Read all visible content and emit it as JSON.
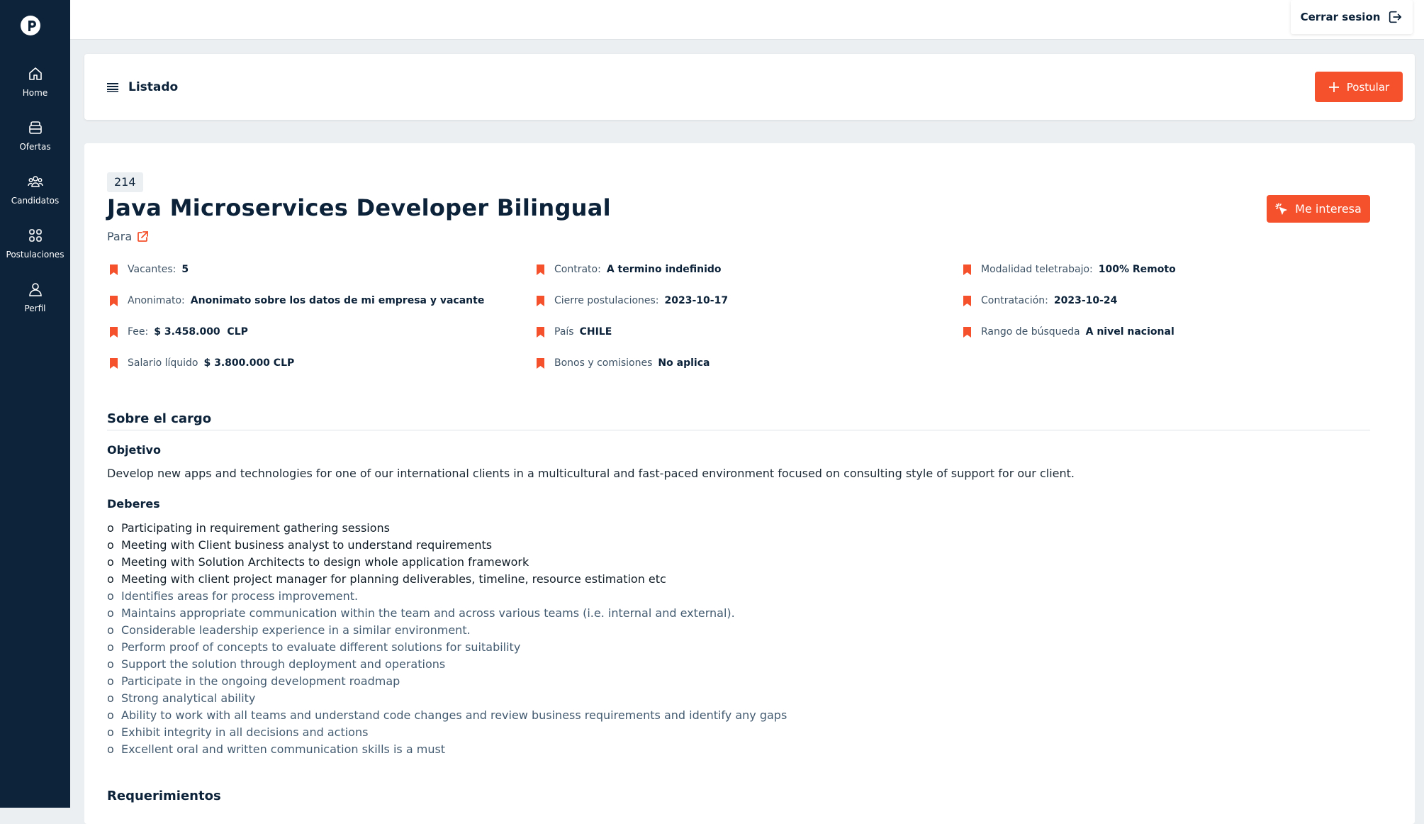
{
  "sidebar": {
    "items": [
      {
        "label": "Home",
        "icon": "home-icon"
      },
      {
        "label": "Ofertas",
        "icon": "briefcase-icon"
      },
      {
        "label": "Candidatos",
        "icon": "users-icon"
      },
      {
        "label": "Postulaciones",
        "icon": "grid-icon"
      },
      {
        "label": "Perfil",
        "icon": "user-icon"
      }
    ]
  },
  "topbar": {
    "logout_label": "Cerrar sesion"
  },
  "header": {
    "listado_label": "Listado",
    "postular_label": "Postular"
  },
  "job": {
    "id": "214",
    "title": "Java Microservices Developer Bilingual",
    "para_label": "Para",
    "interest_label": "Me interesa",
    "attributes": [
      {
        "label": "Vacantes:",
        "value": "5"
      },
      {
        "label": "Contrato:",
        "value": "A termino indefinido"
      },
      {
        "label": "Modalidad teletrabajo:",
        "value": "100% Remoto"
      },
      {
        "label": "Anonimato:",
        "value": "Anonimato sobre los datos de mi empresa y vacante"
      },
      {
        "label": "Cierre postulaciones:",
        "value": "2023-10-17"
      },
      {
        "label": "Contratación:",
        "value": "2023-10-24"
      },
      {
        "label": "Fee:",
        "value": "$ 3.458.000  CLP"
      },
      {
        "label": "País",
        "value": "CHILE"
      },
      {
        "label": "Rango de búsqueda",
        "value": "A nivel nacional"
      },
      {
        "label": "Salario líquido",
        "value": "$ 3.800.000 CLP"
      },
      {
        "label": "Bonos y comisiones",
        "value": "No aplica"
      }
    ],
    "about_title": "Sobre el cargo",
    "objective_title": "Objetivo",
    "objective_text": "Develop new apps and technologies for one of our international clients in a multicultural and fast-paced environment focused on consulting style of support for our client.",
    "duties_title": "Deberes",
    "duty_marker": "o",
    "duties": [
      "Participating in requirement gathering sessions",
      "Meeting with Client business analyst to understand requirements",
      "Meeting with Solution Architects to design whole application framework",
      "Meeting with client project manager for planning deliverables, timeline, resource estimation etc",
      "Identifies areas for process improvement.",
      "Maintains appropriate communication within the team and across various teams (i.e. internal and external).",
      "Considerable leadership experience in a similar environment.",
      "Perform proof of concepts to evaluate different solutions for suitability",
      "Support the solution through deployment and operations",
      "Participate in the ongoing development roadmap",
      "Strong analytical ability",
      "Ability to work with all teams and understand code changes and review business requirements and identify any gaps",
      "Exhibit integrity in all decisions and actions",
      "Excellent oral and written communication skills is a must"
    ],
    "requirements_title": "Requerimientos"
  },
  "colors": {
    "sidebar_bg": "#0d2339",
    "accent": "#f4512c",
    "text_dark": "#0b2239",
    "page_bg": "#eceff1"
  }
}
